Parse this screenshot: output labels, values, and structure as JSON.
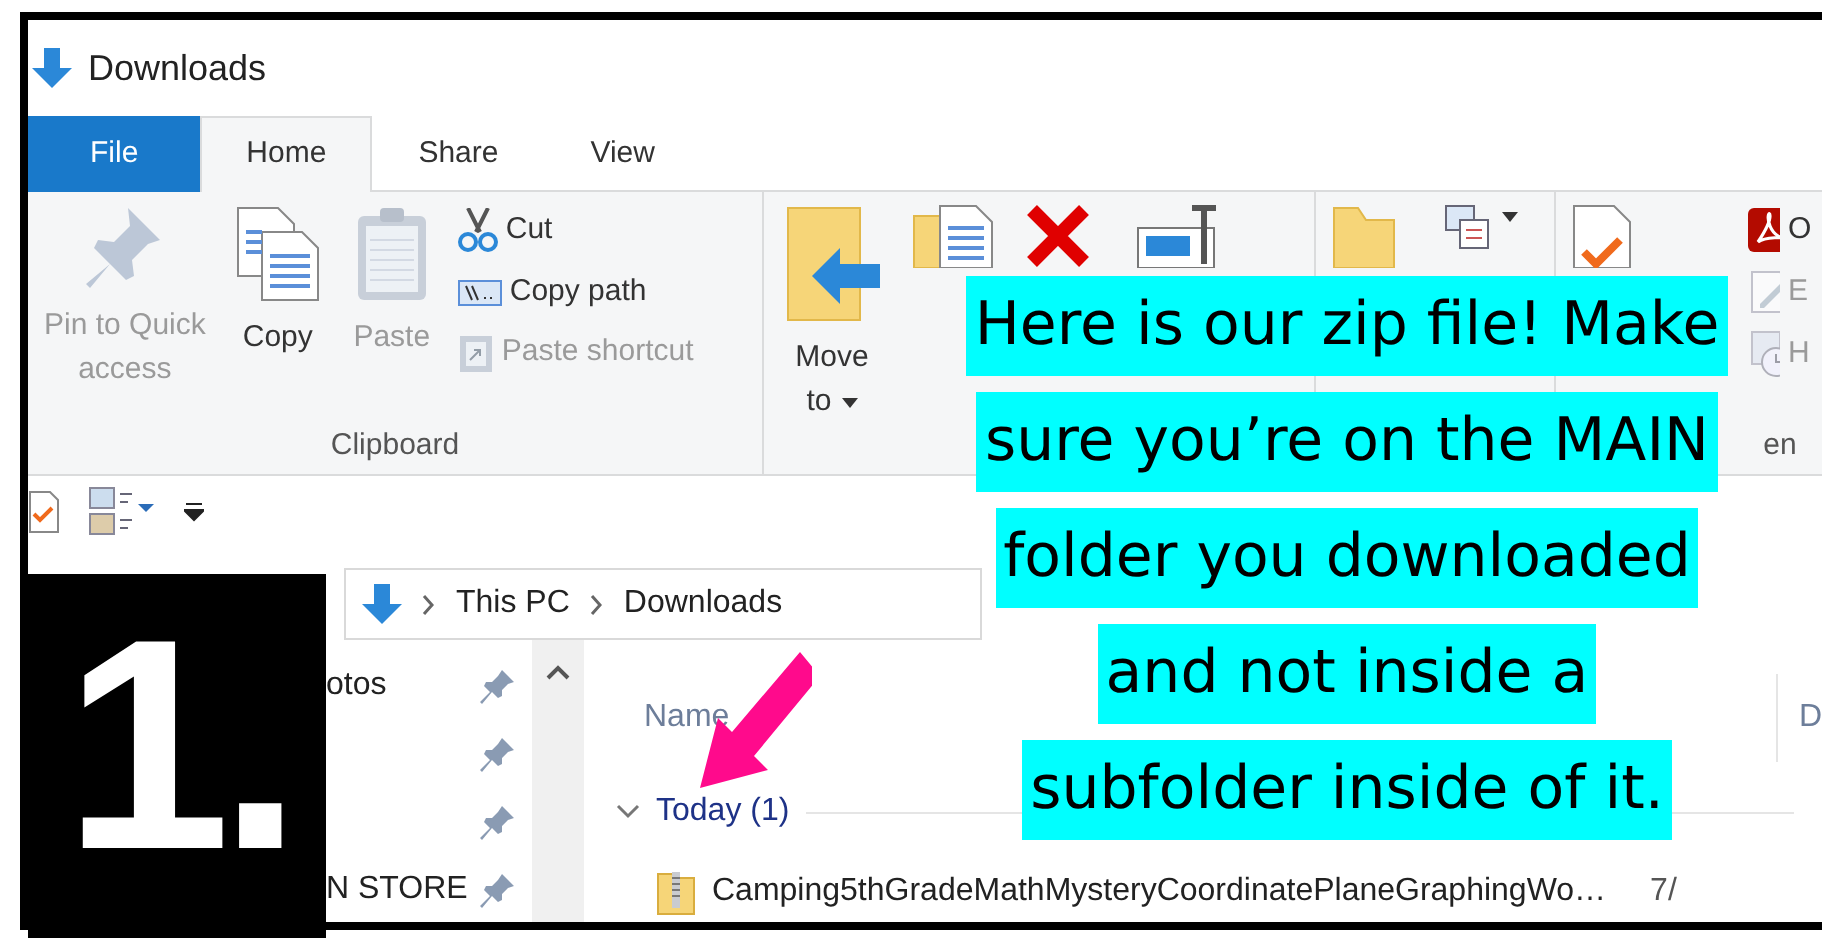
{
  "window": {
    "title": "Downloads"
  },
  "ribbon_tabs": [
    {
      "label": "File",
      "kind": "file",
      "selected": false
    },
    {
      "label": "Home",
      "kind": "tab",
      "selected": true
    },
    {
      "label": "Share",
      "kind": "tab",
      "selected": false
    },
    {
      "label": "View",
      "kind": "tab",
      "selected": false
    }
  ],
  "ribbon": {
    "groups": [
      {
        "label": "Clipboard",
        "buttons": [
          {
            "kind": "pin",
            "label": "Pin to Quick access",
            "disabled": true
          },
          {
            "kind": "copy",
            "label": "Copy",
            "disabled": false
          },
          {
            "kind": "paste",
            "label": "Paste",
            "disabled": true
          }
        ],
        "small_buttons": [
          {
            "kind": "cut",
            "label": "Cut",
            "disabled": false
          },
          {
            "kind": "copypath",
            "label": "Copy path",
            "disabled": false
          },
          {
            "kind": "pasteshortcut",
            "label": "Paste shortcut",
            "disabled": true
          }
        ]
      },
      {
        "buttons": [
          {
            "kind": "move",
            "label": "Move to",
            "dropdown": true
          },
          {
            "kind": "copyto"
          },
          {
            "kind": "delete"
          },
          {
            "kind": "rename"
          }
        ]
      },
      {
        "buttons": [
          {
            "kind": "newfolder"
          },
          {
            "kind": "newitem",
            "dropdown": true
          }
        ]
      },
      {
        "label": "en",
        "buttons": [
          {
            "kind": "properties"
          }
        ],
        "small_buttons": [
          {
            "kind": "pdf",
            "label": "O",
            "disabled": false
          },
          {
            "kind": "edit",
            "label": "E",
            "disabled": true
          },
          {
            "kind": "history",
            "label": "H",
            "disabled": true
          }
        ]
      }
    ]
  },
  "breadcrumb": [
    "This PC",
    "Downloads"
  ],
  "sidebar": {
    "items": [
      {
        "label": "otos",
        "pinned": true
      },
      {
        "pinned": true
      },
      {
        "pinned": true
      },
      {
        "label": "N STORE",
        "pinned": true
      }
    ]
  },
  "columns": [
    "Name",
    "D"
  ],
  "groups": [
    {
      "label": "Today (1)",
      "expanded": true,
      "files": [
        {
          "name": "Camping5thGradeMathMysteryCoordinatePlaneGraphingWo…",
          "column_2": "7/"
        }
      ]
    }
  ],
  "annotation": {
    "step": "1.",
    "lines": [
      "Here is our zip file! Make",
      "sure you’re on the MAIN",
      "folder you downloaded",
      "and not inside a",
      "subfolder inside of it."
    ]
  }
}
